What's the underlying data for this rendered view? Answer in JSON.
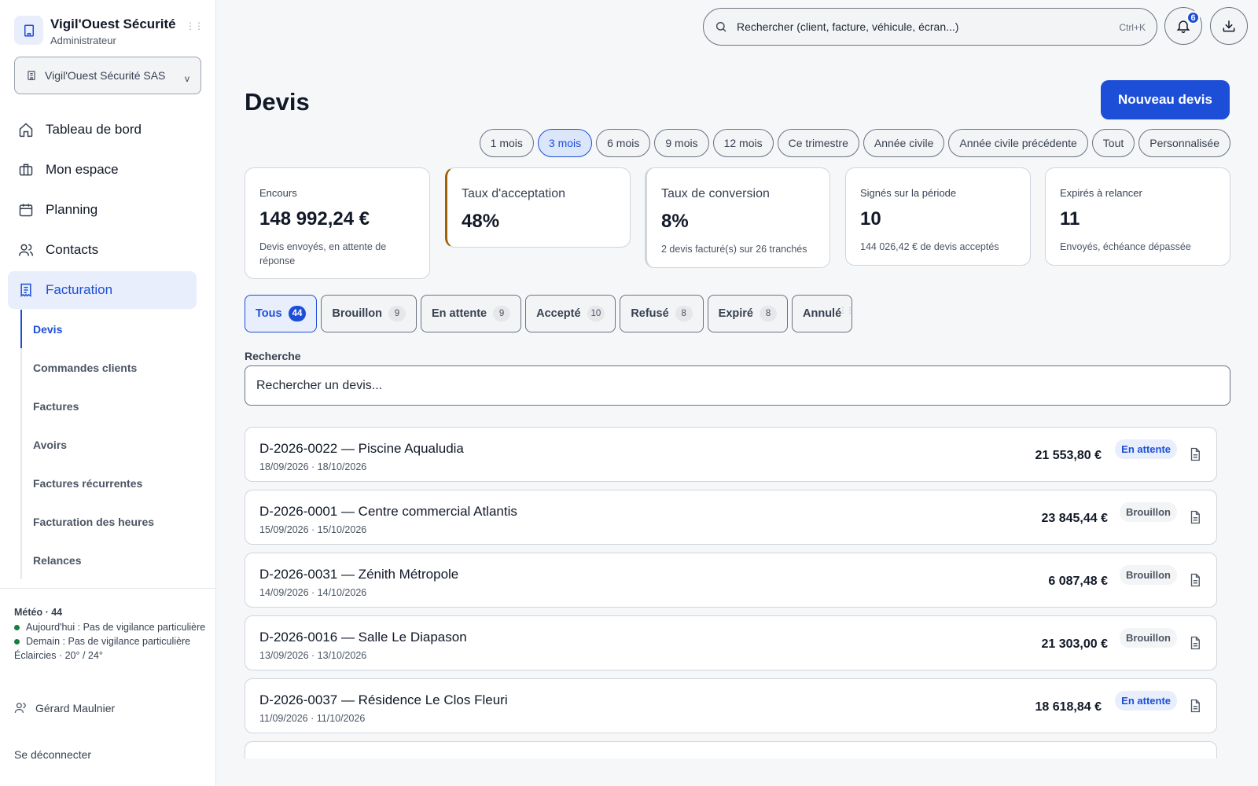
{
  "brand": {
    "name": "Vigil'Ouest Sécurité",
    "role": "Administrateur",
    "company": "Vigil'Ouest Sécurité SAS",
    "company_chevron": "v"
  },
  "nav": [
    {
      "label": "Tableau de bord",
      "icon": "home-icon"
    },
    {
      "label": "Mon espace",
      "icon": "briefcase-icon"
    },
    {
      "label": "Planning",
      "icon": "calendar-icon"
    },
    {
      "label": "Contacts",
      "icon": "users-icon"
    },
    {
      "label": "Facturation",
      "icon": "invoice-icon",
      "active": true
    }
  ],
  "subnav": [
    {
      "label": "Devis",
      "active": true
    },
    {
      "label": "Commandes clients"
    },
    {
      "label": "Factures"
    },
    {
      "label": "Avoirs"
    },
    {
      "label": "Factures récurrentes"
    },
    {
      "label": "Facturation des heures"
    },
    {
      "label": "Relances"
    }
  ],
  "weather": {
    "title": "Météo · 44",
    "today": "Aujourd'hui : Pas de vigilance particulière",
    "tomorrow": "Demain : Pas de vigilance particulière",
    "summary": "Éclaircies · 20° / 24°",
    "dot_color": "#15803d"
  },
  "user": {
    "name": "Gérard Maulnier"
  },
  "logout": "Se déconnecter",
  "topbar": {
    "search_placeholder": "Rechercher (client, facture, véhicule, écran...)",
    "shortcut": "Ctrl+K",
    "notifications_count": "6"
  },
  "page": {
    "title": "Devis",
    "new_button": "Nouveau devis",
    "accent": "#1d4ed8"
  },
  "periods": [
    {
      "label": "1 mois"
    },
    {
      "label": "3 mois",
      "active": true
    },
    {
      "label": "6 mois"
    },
    {
      "label": "9 mois"
    },
    {
      "label": "12 mois"
    },
    {
      "label": "Ce trimestre"
    },
    {
      "label": "Année civile"
    },
    {
      "label": "Année civile précédente"
    },
    {
      "label": "Tout"
    },
    {
      "label": "Personnalisée"
    }
  ],
  "kpis": [
    {
      "label": "Encours",
      "value": "148 992,24 €",
      "sub": "Devis envoyés, en attente de réponse"
    },
    {
      "label": "Taux d'acceptation",
      "value": "48%",
      "sub": ""
    },
    {
      "label": "Taux de conversion",
      "value": "8%",
      "sub": "2 devis facturé(s) sur 26 tranchés"
    },
    {
      "label": "Signés sur la période",
      "value": "10",
      "sub": "144 026,42 € de devis acceptés"
    },
    {
      "label": "Expirés à relancer",
      "value": "11",
      "sub": "Envoyés, échéance dépassée"
    }
  ],
  "status_tabs": [
    {
      "label": "Tous",
      "count": "44",
      "active": true
    },
    {
      "label": "Brouillon",
      "count": "9"
    },
    {
      "label": "En attente",
      "count": "9"
    },
    {
      "label": "Accepté",
      "count": "10"
    },
    {
      "label": "Refusé",
      "count": "8"
    },
    {
      "label": "Expiré",
      "count": "8"
    },
    {
      "label": "Annulé",
      "count": ""
    }
  ],
  "search": {
    "label": "Recherche",
    "placeholder": "Rechercher un devis..."
  },
  "quotes": [
    {
      "title": "D-2026-0022 — Piscine Aqualudia",
      "dates": "18/09/2026 · 18/10/2026",
      "amount": "21 553,80 €",
      "status": "En attente",
      "kind": "pending"
    },
    {
      "title": "D-2026-0001 — Centre commercial Atlantis",
      "dates": "15/09/2026 · 15/10/2026",
      "amount": "23 845,44 €",
      "status": "Brouillon",
      "kind": "draft"
    },
    {
      "title": "D-2026-0031 — Zénith Métropole",
      "dates": "14/09/2026 · 14/10/2026",
      "amount": "6 087,48 €",
      "status": "Brouillon",
      "kind": "draft"
    },
    {
      "title": "D-2026-0016 — Salle Le Diapason",
      "dates": "13/09/2026 · 13/10/2026",
      "amount": "21 303,00 €",
      "status": "Brouillon",
      "kind": "draft"
    },
    {
      "title": "D-2026-0037 — Résidence Le Clos Fleuri",
      "dates": "11/09/2026 · 11/10/2026",
      "amount": "18 618,84 €",
      "status": "En attente",
      "kind": "pending"
    }
  ]
}
